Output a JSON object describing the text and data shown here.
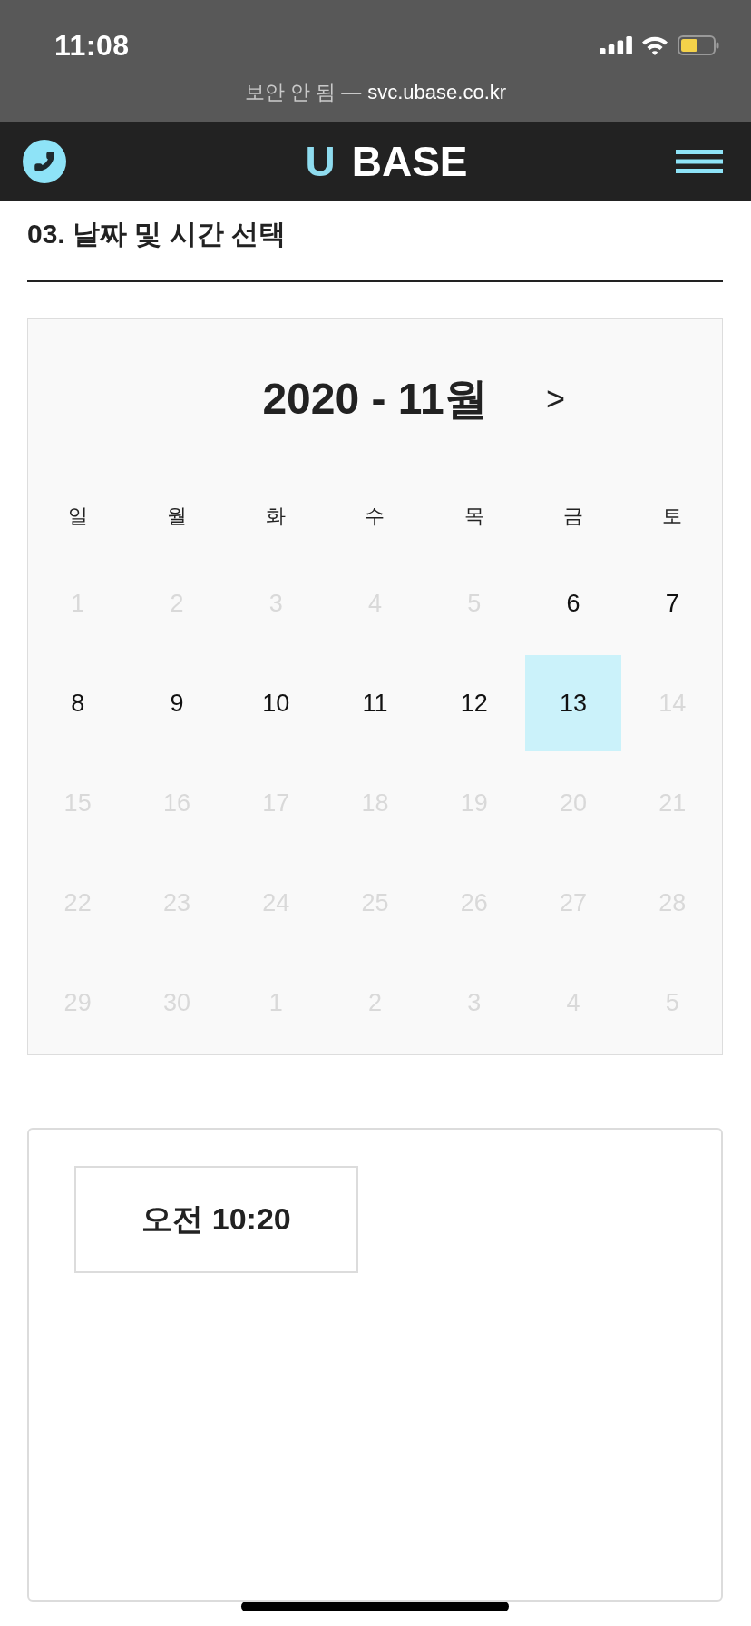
{
  "status_bar": {
    "time": "11:08"
  },
  "address_bar": {
    "security_label": "보안 안 됨 —",
    "domain": "svc.ubase.co.kr"
  },
  "header": {
    "logo": {
      "accent": "U",
      "text": "BASE"
    }
  },
  "section": {
    "title": "03. 날짜 및 시간 선택"
  },
  "calendar": {
    "month_title": "2020 - 11월",
    "next_button": ">",
    "weekdays": [
      "일",
      "월",
      "화",
      "수",
      "목",
      "금",
      "토"
    ],
    "weeks": [
      [
        {
          "label": "1",
          "disabled": true,
          "selected": false
        },
        {
          "label": "2",
          "disabled": true,
          "selected": false
        },
        {
          "label": "3",
          "disabled": true,
          "selected": false
        },
        {
          "label": "4",
          "disabled": true,
          "selected": false
        },
        {
          "label": "5",
          "disabled": true,
          "selected": false
        },
        {
          "label": "6",
          "disabled": false,
          "selected": false
        },
        {
          "label": "7",
          "disabled": false,
          "selected": false
        }
      ],
      [
        {
          "label": "8",
          "disabled": false,
          "selected": false
        },
        {
          "label": "9",
          "disabled": false,
          "selected": false
        },
        {
          "label": "10",
          "disabled": false,
          "selected": false
        },
        {
          "label": "11",
          "disabled": false,
          "selected": false
        },
        {
          "label": "12",
          "disabled": false,
          "selected": false
        },
        {
          "label": "13",
          "disabled": false,
          "selected": true
        },
        {
          "label": "14",
          "disabled": true,
          "selected": false
        }
      ],
      [
        {
          "label": "15",
          "disabled": true,
          "selected": false
        },
        {
          "label": "16",
          "disabled": true,
          "selected": false
        },
        {
          "label": "17",
          "disabled": true,
          "selected": false
        },
        {
          "label": "18",
          "disabled": true,
          "selected": false
        },
        {
          "label": "19",
          "disabled": true,
          "selected": false
        },
        {
          "label": "20",
          "disabled": true,
          "selected": false
        },
        {
          "label": "21",
          "disabled": true,
          "selected": false
        }
      ],
      [
        {
          "label": "22",
          "disabled": true,
          "selected": false
        },
        {
          "label": "23",
          "disabled": true,
          "selected": false
        },
        {
          "label": "24",
          "disabled": true,
          "selected": false
        },
        {
          "label": "25",
          "disabled": true,
          "selected": false
        },
        {
          "label": "26",
          "disabled": true,
          "selected": false
        },
        {
          "label": "27",
          "disabled": true,
          "selected": false
        },
        {
          "label": "28",
          "disabled": true,
          "selected": false
        }
      ],
      [
        {
          "label": "29",
          "disabled": true,
          "selected": false
        },
        {
          "label": "30",
          "disabled": true,
          "selected": false
        },
        {
          "label": "1",
          "disabled": true,
          "selected": false
        },
        {
          "label": "2",
          "disabled": true,
          "selected": false
        },
        {
          "label": "3",
          "disabled": true,
          "selected": false
        },
        {
          "label": "4",
          "disabled": true,
          "selected": false
        },
        {
          "label": "5",
          "disabled": true,
          "selected": false
        }
      ]
    ]
  },
  "time_slots": [
    {
      "label": "오전 10:20"
    }
  ]
}
